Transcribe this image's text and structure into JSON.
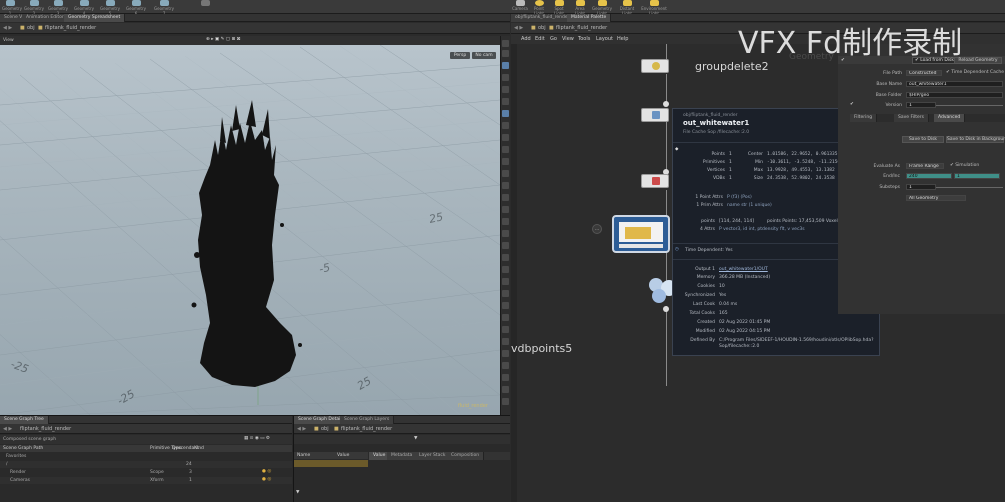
{
  "shelf_left": [
    {
      "label": "Geometry 1"
    },
    {
      "label": "Geometry 2"
    },
    {
      "label": "Geometry 3"
    },
    {
      "label": "Geometry 4"
    },
    {
      "label": "Geometry 5"
    },
    {
      "label": "Geometry 6"
    },
    {
      "label": "Geometry 7"
    }
  ],
  "shelf_right": [
    {
      "label": "Camera"
    },
    {
      "label": "Point Light"
    },
    {
      "label": "Spot Light"
    },
    {
      "label": "Area Light"
    },
    {
      "label": "Geometry Light"
    },
    {
      "label": "Distant Light"
    },
    {
      "label": "Environment Light"
    }
  ],
  "left_tabs": [
    "Scene View",
    "Animation Editor",
    "Geometry Spreadsheet"
  ],
  "left_path": {
    "context": "obj",
    "node": "fliptank_fluid_render"
  },
  "viewport": {
    "label": "View",
    "persp": "Persp",
    "cam": "No cam",
    "grid_labels": [
      "-5",
      "-25",
      "-25",
      "25",
      "25"
    ],
    "corner_text": "fluid_render"
  },
  "right_tabs": [
    "obj/fliptank_fluid_render",
    "Material Palette"
  ],
  "right_path": {
    "context": "obj",
    "node": "fliptank_fluid_render"
  },
  "menu": [
    "Add",
    "Edit",
    "Go",
    "View",
    "Tools",
    "Layout",
    "Help"
  ],
  "network": {
    "context_label": "Geometry",
    "nodes": [
      {
        "name": "groupdelete2"
      },
      {
        "name": "out_whitewater1"
      },
      {
        "name": "vdbpoints5"
      }
    ],
    "cable_badge": "..."
  },
  "popup": {
    "path": "obj/fliptank_fluid_render",
    "title": "out_whitewater1",
    "subtitle": "File Cache Sop /filecache::2.0",
    "stats": [
      {
        "k": "Points",
        "v": "1",
        "k2": "Center",
        "v2": "1.01586,  22.9652,  0.961335"
      },
      {
        "k": "Primitives",
        "v": "1",
        "k2": "Min",
        "v2": "-10.3611,  -3.5248,  -11.2156"
      },
      {
        "k": "Vertices",
        "v": "1",
        "k2": "Max",
        "v2": "13.9928,  49.4553,  13.1382"
      },
      {
        "k": "VDBs",
        "v": "1",
        "k2": "Size",
        "v2": "24.3538,  52.9802,  24.3538"
      }
    ],
    "attrs": [
      {
        "k": "1 Point Attrs",
        "v": "P (f3) (Pos)"
      },
      {
        "k": "1 Prim Attrs",
        "v": "name str (1 unique)"
      }
    ],
    "vdb": {
      "k": "points",
      "v": "[114, 244, 114]",
      "k2": "points Points: 17,453,509  Voxel Size: 0.21362",
      "k3": "4 Attrs",
      "v3": "P vector3, id int, ptdensity flt, v vec3s"
    },
    "time_dep": "Time Dependent: Yes",
    "info": [
      {
        "k": "Output 1",
        "v": "out_whitewater1/OUT"
      },
      {
        "k": "Memory",
        "v": "366.28 MB (Instanced)"
      },
      {
        "k": "Cookies",
        "v": "10"
      },
      {
        "k": "Synchronized",
        "v": "Yes"
      },
      {
        "k": "Last Cook",
        "v": "0.04 ms"
      },
      {
        "k": "Total Cooks",
        "v": "165"
      },
      {
        "k": "Created",
        "v": "02 Aug 2022 01:45 PM"
      },
      {
        "k": "Modified",
        "v": "02 Aug 2022 04:15 PM"
      },
      {
        "k": "Defined By",
        "v": "C:/Program Files/SIDEEF-1/HOUDIN-1.569/houdini/otls/OPlibSop.hda?Sop/filecache::2.0"
      }
    ]
  },
  "params": {
    "context": "Geometry",
    "load_from_disk": "Load from Disk",
    "reload_geometry": "Reload Geometry",
    "rows": [
      {
        "label": "File Path",
        "value": "Constructed",
        "extra": "Time Dependent Cache"
      },
      {
        "label": "Base Name",
        "value": "out_whitewater1"
      },
      {
        "label": "Base Folder",
        "value": "$HIP/geo"
      },
      {
        "label": "Version",
        "value": "1"
      }
    ],
    "tabs": [
      "Filtering",
      "Save Filters",
      "Advanced"
    ],
    "save_to_disk": "Save to Disk",
    "save_bg": "Save to Disk in Background",
    "evaluate_as": "Evaluate As",
    "frame_range": "Frame Range",
    "simulation": "Simulation",
    "end_inc": "End/Inc",
    "end_value": "240",
    "inc_value": "1",
    "substeps": "Substeps",
    "substeps_value": "1",
    "geometry": "All Geometry"
  },
  "bottom_left": {
    "tabs": [
      "Scene Graph Tree"
    ],
    "path": "fliptank_fluid_render",
    "label": "Composed scene graph",
    "columns": [
      "Scene Graph Path",
      "Primitive Type",
      "Descendant",
      "Kind"
    ],
    "rows": [
      {
        "path": "Favorites",
        "type": "",
        "desc": "",
        "kind": ""
      },
      {
        "path": "/",
        "type": "",
        "desc": "24",
        "kind": ""
      },
      {
        "path": "Render",
        "type": "Scope",
        "desc": "3",
        "kind": ""
      },
      {
        "path": "Cameras",
        "type": "Xform",
        "desc": "1",
        "kind": ""
      }
    ]
  },
  "bottom_right": {
    "tabs": [
      "Scene Graph Details",
      "Scene Graph Layers"
    ],
    "path_ctx": "obj",
    "path_node": "fliptank_fluid_render",
    "columns": [
      "Name",
      "Value"
    ],
    "value_tabs": [
      "Value",
      "Metadata",
      "Layer Stack",
      "Composition"
    ]
  },
  "watermark": "VFX Fd制作录制"
}
